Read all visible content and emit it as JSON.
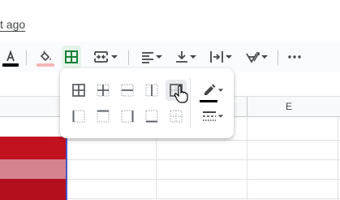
{
  "header": {
    "last_edit_text": "t ago"
  },
  "toolbar": {
    "buttons": [
      {
        "name": "text-color-button",
        "icon": "text-color-icon"
      },
      {
        "name": "fill-color-button",
        "icon": "fill-color-icon"
      },
      {
        "name": "borders-button",
        "icon": "borders-icon",
        "active": true
      },
      {
        "name": "merge-cells-button",
        "icon": "merge-cells-icon"
      },
      {
        "name": "horizontal-align-button",
        "icon": "align-left-icon"
      },
      {
        "name": "vertical-align-button",
        "icon": "vertical-align-bottom-icon"
      },
      {
        "name": "text-wrapping-button",
        "icon": "text-wrap-icon"
      },
      {
        "name": "text-rotation-button",
        "icon": "text-rotation-icon"
      },
      {
        "name": "more-button",
        "icon": "more-horiz-icon"
      }
    ],
    "text_color_swatch": "#000000",
    "fill_color_swatch": "#f4b6b6"
  },
  "grid": {
    "column_labels": [
      "E"
    ],
    "cell_colors": [
      "#c2111f",
      "#d4838f",
      "#b30e1e"
    ]
  },
  "borders_menu": {
    "options_row1": [
      "all-borders-icon",
      "inner-borders-icon",
      "horizontal-borders-icon",
      "vertical-borders-icon",
      "outer-borders-icon"
    ],
    "options_row2": [
      "left-border-icon",
      "top-border-icon",
      "right-border-icon",
      "bottom-border-icon",
      "clear-borders-icon"
    ],
    "selected": "outer-borders-icon",
    "border_color": "#000000",
    "extra_icons": [
      "border-color-icon",
      "border-style-icon"
    ]
  },
  "colors": {
    "accent_green": "#188038",
    "active_bg": "#e6f4ea"
  }
}
